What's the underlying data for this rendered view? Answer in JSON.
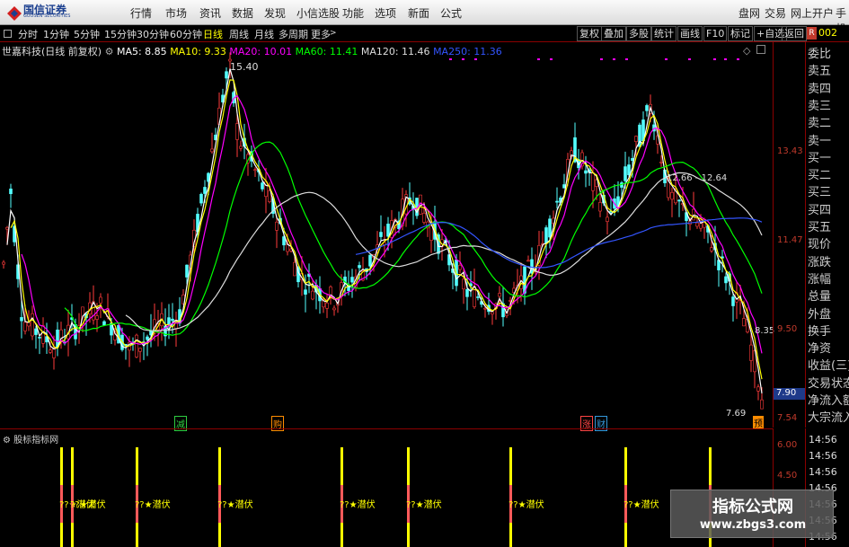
{
  "app": {
    "logo_text": "国信证券",
    "logo_sub": "GUOSEN SECURITIES",
    "menu": [
      "行情",
      "市场",
      "资讯",
      "数据",
      "发现",
      "小信选股",
      "功能",
      "选项",
      "新面",
      "公式"
    ],
    "right_menu": [
      "盘网",
      "交易",
      "网上开户",
      "手机"
    ]
  },
  "toolbar": {
    "periods": [
      "分时",
      "1分钟",
      "5分钟",
      "15分钟",
      "30分钟",
      "60分钟",
      "日线",
      "周线",
      "月线",
      "多周期",
      "更多"
    ],
    "selected": "日线",
    "right_buttons": [
      "复权",
      "叠加",
      "多股",
      "统计",
      "画线",
      "F10",
      "标记",
      "+自选",
      "返回"
    ],
    "r_badge": "R",
    "code_part": "002"
  },
  "chart": {
    "stock_title": "世嘉科技(日线 前复权)",
    "ma": [
      {
        "label": "MA5: 8.85",
        "color": "#ffffff"
      },
      {
        "label": "MA10: 9.33",
        "color": "#ffff00"
      },
      {
        "label": "MA20: 10.01",
        "color": "#ff00ff"
      },
      {
        "label": "MA60: 11.41",
        "color": "#00ff00"
      },
      {
        "label": "MA120: 11.46",
        "color": "#dddddd"
      },
      {
        "label": "MA250: 11.36",
        "color": "#3355ff"
      }
    ],
    "high_label": "15.40",
    "low_label": "7.69",
    "range_label": "12.66 - 12.64",
    "price_label_right": "8.35",
    "axis_ticks": [
      "13.43",
      "11.47",
      "9.50",
      "7.54"
    ],
    "current_price": "7.90",
    "event_tags": [
      {
        "text": "减",
        "color": "#2ecc40"
      },
      {
        "text": "购",
        "color": "#ff8c00"
      },
      {
        "text": "涨",
        "color": "#ff4444"
      },
      {
        "text": "财",
        "color": "#3498db"
      },
      {
        "text": "预",
        "color": "#ff8c00"
      }
    ]
  },
  "side_panel": {
    "items": [
      "委比",
      "卖五",
      "卖四",
      "卖三",
      "卖二",
      "卖一",
      "买一",
      "买二",
      "买三",
      "买四",
      "买五",
      "现价",
      "涨跌",
      "涨幅",
      "总量",
      "外盘",
      "换手",
      "净资",
      "收益(三)",
      "交易状态",
      "净流入额",
      "大宗流入"
    ]
  },
  "indicator": {
    "title": "股标指标网",
    "axis": [
      "6.00",
      "4.50"
    ],
    "signal_label": "??★潜伏",
    "times": [
      "14:56",
      "14:56",
      "14:56",
      "14:56",
      "14:56",
      "14:56",
      "14:56"
    ]
  },
  "watermark": {
    "line1": "指标公式网",
    "line2": "www.zbgs3.com"
  }
}
